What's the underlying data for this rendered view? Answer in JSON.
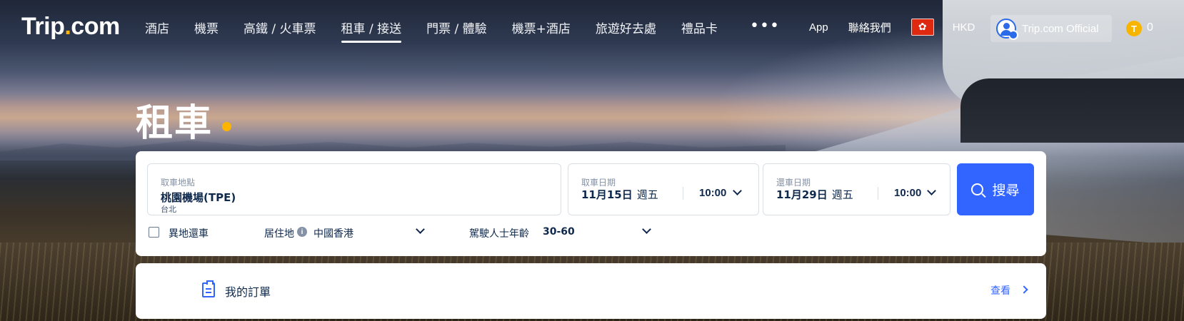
{
  "header": {
    "logo_text": "Trip",
    "logo_dot": ".",
    "logo_suffix": "com",
    "nav": [
      "酒店",
      "機票",
      "高鐵 / 火車票",
      "租車 / 接送",
      "門票 / 體驗",
      "機票+酒店",
      "旅遊好去處",
      "禮品卡"
    ],
    "more": "•••",
    "app": "App",
    "contact": "聯絡我們",
    "currency": "HKD",
    "account_name": "Trip.com Official",
    "coin_symbol": "T",
    "coin_count": "0"
  },
  "page": {
    "title": "租車"
  },
  "search": {
    "pickup_label": "取車地點",
    "pickup_value": "桃園機場(TPE)",
    "pickup_city": "台北",
    "pickup_date_label": "取車日期",
    "pickup_date": "11月15日",
    "pickup_weekday": "週五",
    "pickup_time": "10:00",
    "return_date_label": "還車日期",
    "return_date": "11月29日",
    "return_weekday": "週五",
    "return_time": "10:00",
    "search_button": "搜尋",
    "diff_return_label": "異地還車",
    "residence_label": "居住地",
    "residence_value": "中國香港",
    "driver_age_label": "駕駛人士年齡",
    "driver_age_value": "30-60"
  },
  "orders": {
    "label": "我的訂單",
    "view": "查看"
  }
}
